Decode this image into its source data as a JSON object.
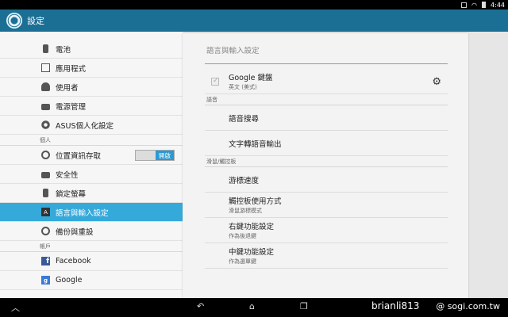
{
  "status": {
    "time": "4:44"
  },
  "actionbar": {
    "title": "設定"
  },
  "sidebar": {
    "items": [
      {
        "label": "電池"
      },
      {
        "label": "應用程式"
      },
      {
        "label": "使用者"
      },
      {
        "label": "電源管理"
      },
      {
        "label": "ASUS個人化設定"
      }
    ],
    "section_personal": "個人",
    "location": {
      "label": "位置資訊存取",
      "toggle": "開啟"
    },
    "personal_items": [
      {
        "label": "安全性"
      },
      {
        "label": "鎖定螢幕"
      },
      {
        "label": "語言與輸入設定"
      },
      {
        "label": "備份與重設"
      }
    ],
    "section_accounts": "帳戶",
    "accounts": [
      {
        "label": "Facebook",
        "icon": "f"
      },
      {
        "label": "Google",
        "icon": "g"
      }
    ]
  },
  "detail": {
    "heading": "語言與輸入設定",
    "keyboard": {
      "title": "Google 鍵盤",
      "subtitle": "英文 (美式)"
    },
    "section_voice": "語音",
    "voice_search": "語音搜尋",
    "tts": "文字轉語音輸出",
    "section_mouse": "滑鼠/觸控板",
    "pointer_speed": "游標速度",
    "touchpad": {
      "title": "觸控板使用方式",
      "subtitle": "滑鼠游標模式"
    },
    "right_key": {
      "title": "右鍵功能設定",
      "subtitle": "作為後退鍵"
    },
    "middle_key": {
      "title": "中鍵功能設定",
      "subtitle": "作為選單鍵"
    }
  },
  "watermark": {
    "user": "brianli813",
    "site": "@ sogi.com.tw"
  }
}
